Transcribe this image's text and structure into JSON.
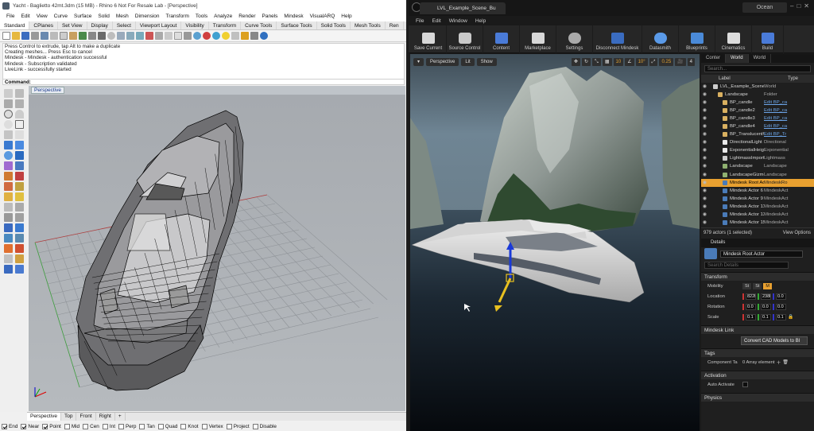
{
  "rhino": {
    "title": "Yacht - Baglietto 42mt.3dm (15 MB) - Rhino 6 Not For Resale Lab - [Perspective]",
    "menu": [
      "File",
      "Edit",
      "View",
      "Curve",
      "Surface",
      "Solid",
      "Mesh",
      "Dimension",
      "Transform",
      "Tools",
      "Analyze",
      "Render",
      "Panels",
      "Mindesk",
      "VisualARQ",
      "Help"
    ],
    "tabs": [
      "Standard",
      "CPlanes",
      "Set View",
      "Display",
      "Select",
      "Viewport Layout",
      "Visibility",
      "Transform",
      "Curve Tools",
      "Surface Tools",
      "Solid Tools",
      "Mesh Tools",
      "Ren"
    ],
    "history": [
      "Press Control to extrude, tap Alt to make a duplicate",
      "Creating meshes... Press Esc to cancel",
      "Mindesk - Mindesk - authentication successful",
      "Mindesk - Subscription validated",
      "LiveLink - successfully started"
    ],
    "command_label": "Command:",
    "viewport_label": "Perspective",
    "view_tabs": [
      "Perspective",
      "Top",
      "Front",
      "Right"
    ],
    "add_tab": "+",
    "osnaps": [
      {
        "label": "End",
        "on": true
      },
      {
        "label": "Near",
        "on": true
      },
      {
        "label": "Point",
        "on": true
      },
      {
        "label": "Mid",
        "on": false
      },
      {
        "label": "Cen",
        "on": false
      },
      {
        "label": "Int",
        "on": false
      },
      {
        "label": "Perp",
        "on": false
      },
      {
        "label": "Tan",
        "on": false
      },
      {
        "label": "Quad",
        "on": false
      },
      {
        "label": "Knot",
        "on": false
      },
      {
        "label": "Vertex",
        "on": false
      },
      {
        "label": "Project",
        "on": false
      },
      {
        "label": "Disable",
        "on": false
      }
    ]
  },
  "unreal": {
    "tab_title": "LVL_Example_Scene_Bu",
    "project_badge": "Ocean",
    "menu": [
      "File",
      "Edit",
      "Window",
      "Help"
    ],
    "toolbar": [
      "Save Current",
      "Source Control",
      "Content",
      "Marketplace",
      "Settings",
      "Disconnect Mindesk",
      "Datasmith",
      "Blueprints",
      "Cinematics",
      "Build"
    ],
    "viewport": {
      "perspective": "Perspective",
      "lit": "Lit",
      "show": "Show",
      "grid": "10",
      "angle": "10°",
      "scale": "0.25",
      "camera": "4"
    },
    "panel_tabs": [
      "Conter",
      "World",
      "World"
    ],
    "search_placeholder": "Search...",
    "col_label": "Label",
    "col_type": "Type",
    "outliner": [
      {
        "name": "LVL_Example_Scene_Bu",
        "type": "World",
        "color": "#cccccc",
        "link": false,
        "selected": false
      },
      {
        "name": "Landscape",
        "type": "Folder",
        "color": "#d9b060",
        "link": false,
        "selected": false
      },
      {
        "name": "BP_candle",
        "type": "Edit BP_ca",
        "color": "#d9b060",
        "link": true,
        "selected": false
      },
      {
        "name": "BP_candle2",
        "type": "Edit BP_ca",
        "color": "#d9b060",
        "link": true,
        "selected": false
      },
      {
        "name": "BP_candle3",
        "type": "Edit BP_ca",
        "color": "#d9b060",
        "link": true,
        "selected": false
      },
      {
        "name": "BP_candle4",
        "type": "Edit BP_ca",
        "color": "#d9b060",
        "link": true,
        "selected": false
      },
      {
        "name": "BP_TranslucentWat",
        "type": "Edit BP_Tr",
        "color": "#d9b060",
        "link": true,
        "selected": false
      },
      {
        "name": "DirectionalLight",
        "type": "Directional",
        "color": "#e8e8e8",
        "link": false,
        "selected": false
      },
      {
        "name": "ExponentialHeightF",
        "type": "Exponential",
        "color": "#e8e8e8",
        "link": false,
        "selected": false
      },
      {
        "name": "LightmassImportanc",
        "type": "Lightmass",
        "color": "#cccccc",
        "link": false,
        "selected": false
      },
      {
        "name": "Landscape",
        "type": "Landscape",
        "color": "#8fb070",
        "link": false,
        "selected": false
      },
      {
        "name": "LandscapeGizmoAc",
        "type": "Landscape",
        "color": "#8fb070",
        "link": false,
        "selected": false
      },
      {
        "name": "Mindesk Root Actor",
        "type": "MindeskRo",
        "color": "#4a7bb8",
        "link": false,
        "selected": true
      },
      {
        "name": "Mindesk Actor 6",
        "type": "MindeskAct",
        "color": "#4a7bb8",
        "link": false,
        "selected": false
      },
      {
        "name": "Mindesk Actor 9",
        "type": "MindeskAct",
        "color": "#4a7bb8",
        "link": false,
        "selected": false
      },
      {
        "name": "Mindesk Actor 11",
        "type": "MindeskAct",
        "color": "#4a7bb8",
        "link": false,
        "selected": false
      },
      {
        "name": "Mindesk Actor 13",
        "type": "MindeskAct",
        "color": "#4a7bb8",
        "link": false,
        "selected": false
      },
      {
        "name": "Mindesk Actor 15",
        "type": "MindeskAct",
        "color": "#4a7bb8",
        "link": false,
        "selected": false
      }
    ],
    "actor_count": "979 actors (1 selected)",
    "view_options": "View Options",
    "details_tab": "Details",
    "actor_name": "Mindesk Root Actor",
    "details_search": "Search Details",
    "transform_header": "Transform",
    "mobility_label": "Mobility",
    "mobility_options": [
      "St",
      "St",
      "M"
    ],
    "location_label": "Location",
    "location": [
      "822k",
      "238k",
      "0.0"
    ],
    "rotation_label": "Rotation",
    "rotation": [
      "0.0",
      "0.0",
      "0.0"
    ],
    "scale_label": "Scale",
    "scale": [
      "0.1",
      "0.1",
      "0.1"
    ],
    "mindesk_link_header": "Mindesk Link",
    "convert_button": "Convert CAD Models to Bl",
    "tags_header": "Tags",
    "component_tags_label": "Component Ta",
    "component_tags_value": "0 Array element",
    "activation_header": "Activation",
    "auto_activate_label": "Auto Activate",
    "physics_header": "Physics"
  }
}
